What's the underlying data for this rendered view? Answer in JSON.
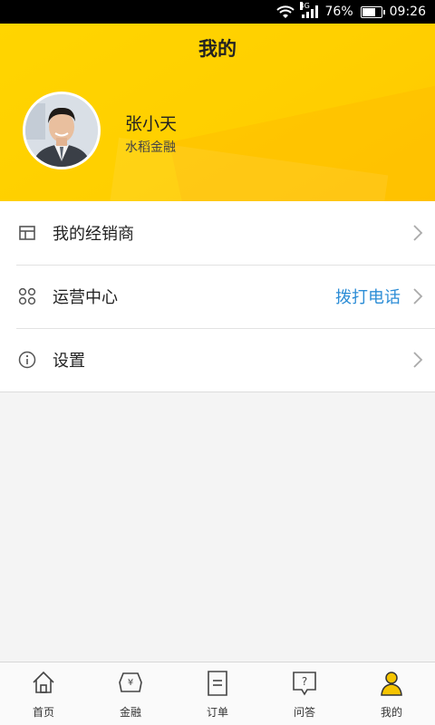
{
  "status_bar": {
    "network": "3G",
    "battery": "76%",
    "battery_level": 0.76,
    "time": "09:26"
  },
  "header": {
    "title": "我的",
    "user_name": "张小天",
    "company": "水稻金融"
  },
  "menu": [
    {
      "label": "我的经销商",
      "icon": "store-icon",
      "action": ""
    },
    {
      "label": "运营中心",
      "icon": "grid-circles-icon",
      "action": "拨打电话"
    },
    {
      "label": "设置",
      "icon": "info-icon",
      "action": ""
    }
  ],
  "tabs": [
    {
      "label": "首页",
      "icon": "home-icon",
      "active": true
    },
    {
      "label": "金融",
      "icon": "finance-icon",
      "active": false
    },
    {
      "label": "订单",
      "icon": "order-icon",
      "active": false
    },
    {
      "label": "问答",
      "icon": "question-icon",
      "active": false
    },
    {
      "label": "我的",
      "icon": "profile-icon",
      "active": false
    }
  ],
  "colors": {
    "header_yellow": "#ffd200",
    "action_blue": "#2c8dd6",
    "profile_tab_yellow": "#f5c400"
  }
}
